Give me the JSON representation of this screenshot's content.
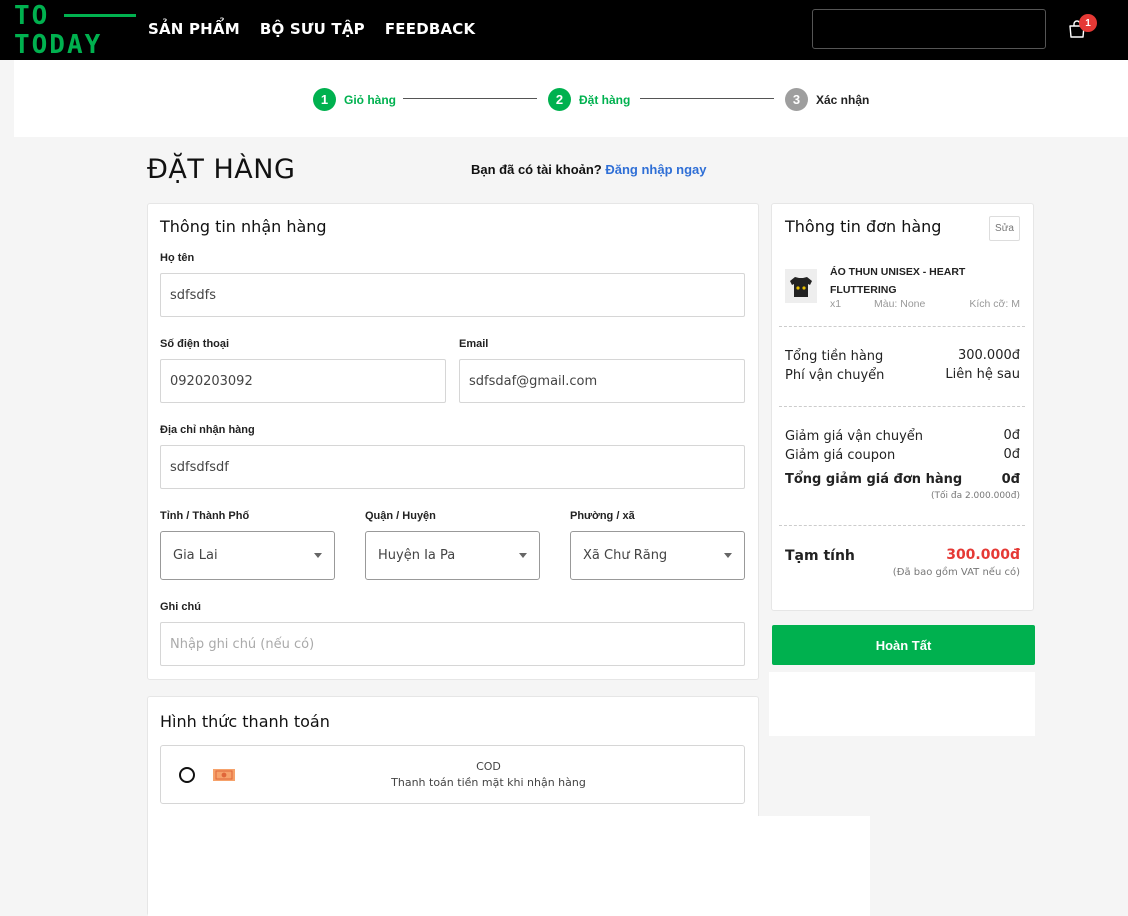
{
  "header": {
    "logo_line1": "TO",
    "logo_line2": "TODAY",
    "nav": [
      "SẢN PHẨM",
      "BỘ SƯU TẬP",
      "FEEDBACK"
    ],
    "cart_count": "1"
  },
  "stepper": [
    {
      "num": "1",
      "label": "Giỏ hàng",
      "state": "active"
    },
    {
      "num": "2",
      "label": "Đặt hàng",
      "state": "active"
    },
    {
      "num": "3",
      "label": "Xác nhận",
      "state": "todo"
    }
  ],
  "page": {
    "title": "ĐẶT HÀNG",
    "login_prompt": "Bạn đã có tài khoản?",
    "login_link": "Đăng nhập ngay"
  },
  "shipping": {
    "title": "Thông tin nhận hàng",
    "name_label": "Họ tên",
    "name_value": "sdfsdfs",
    "phone_label": "Số điện thoại",
    "phone_value": "0920203092",
    "email_label": "Email",
    "email_value": "sdfsdaf@gmail.com",
    "address_label": "Địa chỉ nhận hàng",
    "address_value": "sdfsdfsdf",
    "province_label": "Tỉnh / Thành Phố",
    "province_value": "Gia Lai",
    "district_label": "Quận / Huyện",
    "district_value": "Huyện Ia Pa",
    "ward_label": "Phường / xã",
    "ward_value": "Xã Chư Răng",
    "note_label": "Ghi chú",
    "note_placeholder": "Nhập ghi chú (nếu có)"
  },
  "payment": {
    "title": "Hình thức thanh toán",
    "option_name": "COD",
    "option_desc": "Thanh toán tiền mặt khi nhận hàng"
  },
  "order": {
    "title": "Thông tin đơn hàng",
    "edit_label": "Sửa",
    "product_name_1": "ÁO THUN UNISEX - HEART",
    "product_name_2": "FLUTTERING",
    "qty": "x1",
    "color": "Màu: None",
    "size": "Kích cỡ: M",
    "subtotal_label": "Tổng tiền hàng",
    "subtotal_value": "300.000đ",
    "shipping_label": "Phí vận chuyển",
    "shipping_value": "Liên hệ sau",
    "ship_discount_label": "Giảm giá vận chuyển",
    "ship_discount_value": "0đ",
    "coupon_label": "Giảm giá coupon",
    "coupon_value": "0đ",
    "total_discount_label": "Tổng giảm giá đơn hàng",
    "total_discount_value": "0đ",
    "max_note": "(Tối đa 2.000.000đ)",
    "temp_label": "Tạm tính",
    "temp_value": "300.000đ",
    "vat_note": "(Đã bao gồm VAT nếu có)",
    "complete_label": "Hoàn Tất"
  },
  "colors": {
    "brand": "#00b14f",
    "price": "#e53935",
    "link": "#2f6fd6"
  }
}
